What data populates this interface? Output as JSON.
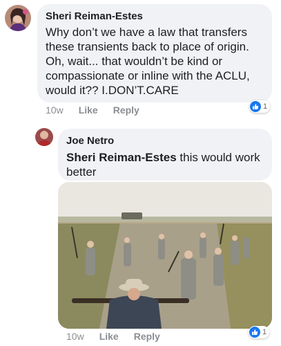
{
  "comments": [
    {
      "author": "Sheri Reiman-Estes",
      "text": "Why don’t we have a law that transfers these transients back to place of origin. Oh, wait... that wouldn’t be kind or compassionate or inline with the ACLU, would it?? I.DON’T.CARE",
      "lines": [
        "Why don’t we have a law that transfers",
        "these transients back to place of origin.",
        "Oh, wait... that wouldn’t be kind or",
        "compassionate or inline with the ACLU,",
        "would it?? I.DON’T.CARE"
      ],
      "time": "10w",
      "like_label": "Like",
      "reply_label": "Reply",
      "reaction_count": "1",
      "colors": {
        "reaction": "#1877f2"
      }
    },
    {
      "author": "Joe Netro",
      "mention": "Sheri Reiman-Estes",
      "text_line1_rest": " this would work",
      "text_line2": "better",
      "time": "10w",
      "like_label": "Like",
      "reply_label": "Reply",
      "reaction_count": "1",
      "image": "photo of men with shovels working on a dirt road"
    }
  ]
}
